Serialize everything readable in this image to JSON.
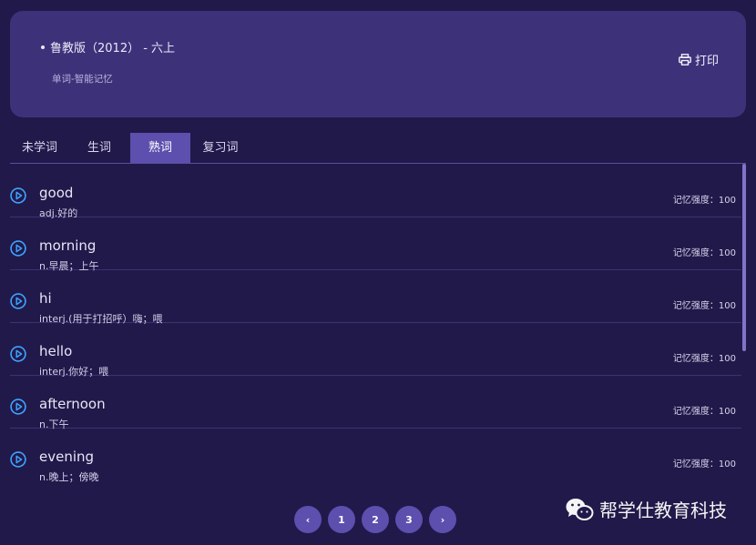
{
  "header": {
    "book": "鲁教版（2012） - 六上",
    "subtitle": "单词-智能记忆",
    "print_label": "打印"
  },
  "tabs": [
    {
      "label": "未学词",
      "active": false
    },
    {
      "label": "生词",
      "active": false
    },
    {
      "label": "熟词",
      "active": true
    },
    {
      "label": "复习词",
      "active": false
    }
  ],
  "words": [
    {
      "word": "good",
      "meaning": "adj.好的",
      "strength": "记忆强度：100"
    },
    {
      "word": "morning",
      "meaning": "n.早晨；上午",
      "strength": "记忆强度：100"
    },
    {
      "word": "hi",
      "meaning": "interj.(用于打招呼）嗨；喂",
      "strength": "记忆强度：100"
    },
    {
      "word": "hello",
      "meaning": "interj.你好；喂",
      "strength": "记忆强度：100"
    },
    {
      "word": "afternoon",
      "meaning": "n.下午",
      "strength": "记忆强度：100"
    },
    {
      "word": "evening",
      "meaning": "n.晚上；傍晚",
      "strength": "记忆强度：100"
    }
  ],
  "pagination": {
    "prev": "‹",
    "pages": [
      "1",
      "2",
      "3"
    ],
    "next": "›"
  },
  "watermark": "帮学仕教育科技",
  "colors": {
    "background": "#21194a",
    "card": "#3d327a",
    "accent": "#5c4fae",
    "play_icon": "#3ea3ff"
  }
}
